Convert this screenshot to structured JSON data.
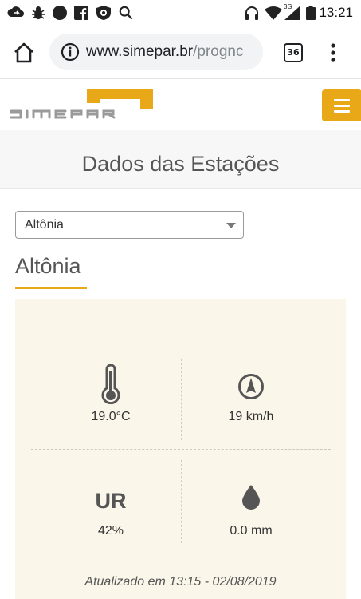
{
  "status_bar": {
    "time": "13:21",
    "left_icons": [
      "cloud-sync-icon",
      "bug-icon",
      "circle-icon",
      "facebook-icon",
      "shield-icon",
      "search-icon"
    ],
    "right_icons": [
      "headphones-icon",
      "wifi-icon",
      "signal-icon",
      "battery-icon"
    ],
    "network_label": "3G"
  },
  "browser": {
    "url_host": "www.simepar.br",
    "url_path": "/prognc",
    "tab_count": "36"
  },
  "site": {
    "logo_text": "SIMEPAR",
    "brand_color": "#e8a817"
  },
  "page": {
    "title": "Dados das Estações"
  },
  "station_select": {
    "selected": "Altônia"
  },
  "station": {
    "name": "Altônia",
    "temperature": "19.0°C",
    "wind": "19 km/h",
    "humidity_label": "UR",
    "humidity": "42%",
    "rain": "0.0 mm",
    "updated": "Atualizado em 13:15 - 02/08/2019"
  }
}
